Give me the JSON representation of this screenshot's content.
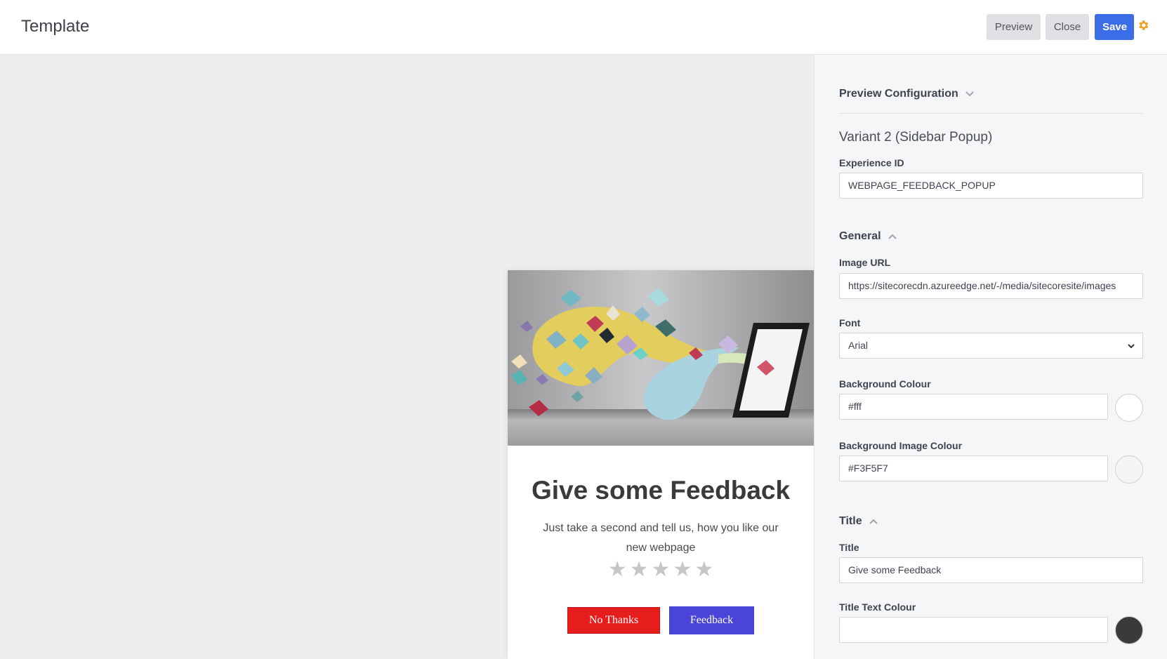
{
  "header": {
    "title": "Template",
    "preview_label": "Preview",
    "close_label": "Close",
    "save_label": "Save",
    "settings_icon": "gear-icon"
  },
  "popup": {
    "title": "Give some Feedback",
    "text": "Just take a second and tell us, how you like our new webpage",
    "stars": [
      "★",
      "★",
      "★",
      "★",
      "★"
    ],
    "no_thanks_label": "No Thanks",
    "feedback_label": "Feedback",
    "colors": {
      "no_thanks": "#e71c1c",
      "feedback": "#4a45d8"
    }
  },
  "sidebar": {
    "preview_config_label": "Preview Configuration",
    "variant_label": "Variant 2 (Sidebar Popup)",
    "experience_id_label": "Experience ID",
    "experience_id_value": "WEBPAGE_FEEDBACK_POPUP",
    "general_label": "General",
    "image_url_label": "Image URL",
    "image_url_value": "https://sitecorecdn.azureedge.net/-/media/sitecoresite/images",
    "font_label": "Font",
    "font_value": "Arial",
    "background_colour_label": "Background Colour",
    "background_colour_value": "#fff",
    "background_image_colour_label": "Background Image Colour",
    "background_image_colour_value": "#F3F5F7",
    "title_section_label": "Title",
    "title_label": "Title",
    "title_value": "Give some Feedback",
    "title_text_colour_label": "Title Text Colour"
  }
}
